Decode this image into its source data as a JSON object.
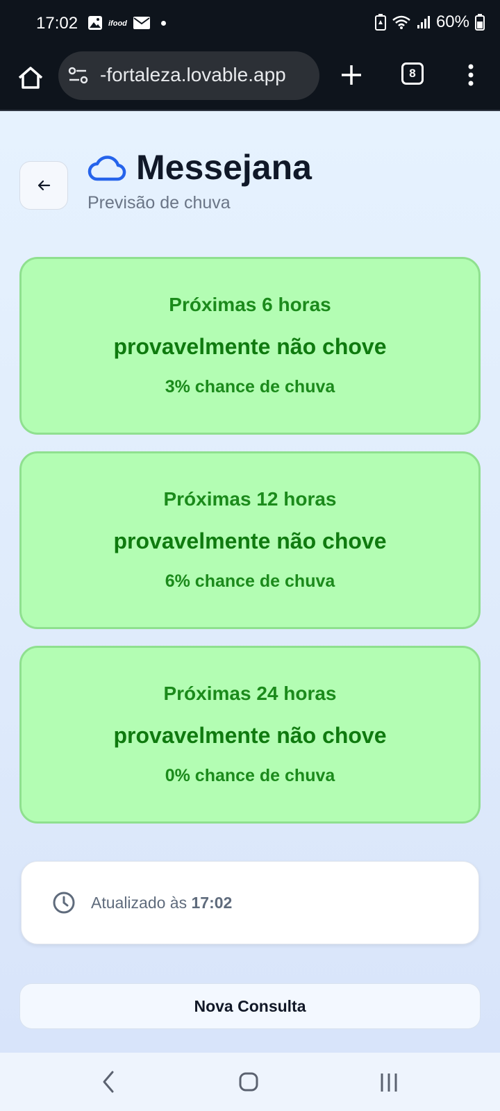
{
  "status_bar": {
    "time": "17:02",
    "battery": "60%",
    "icons_left": [
      "image-icon",
      "ifood-icon",
      "mail-icon",
      "dot-icon"
    ],
    "icons_right": [
      "battery-saver-icon",
      "wifi-icon",
      "signal-icon",
      "battery-icon"
    ]
  },
  "browser": {
    "url": "-fortaleza.lovable.app",
    "tab_count": "8"
  },
  "header": {
    "title": "Messejana",
    "subtitle": "Previsão de chuva"
  },
  "forecasts": [
    {
      "period": "Próximas 6 horas",
      "status": "provavelmente não chove",
      "chance": "3% chance de chuva"
    },
    {
      "period": "Próximas 12 horas",
      "status": "provavelmente não chove",
      "chance": "6% chance de chuva"
    },
    {
      "period": "Próximas 24 horas",
      "status": "provavelmente não chove",
      "chance": "0% chance de chuva"
    }
  ],
  "updated": {
    "label": "Atualizado às",
    "time": "17:02"
  },
  "actions": {
    "new_query": "Nova Consulta"
  },
  "colors": {
    "card_background": "#b3fdb3",
    "card_text": "#1b8a1b",
    "accent_blue": "#2563eb"
  }
}
